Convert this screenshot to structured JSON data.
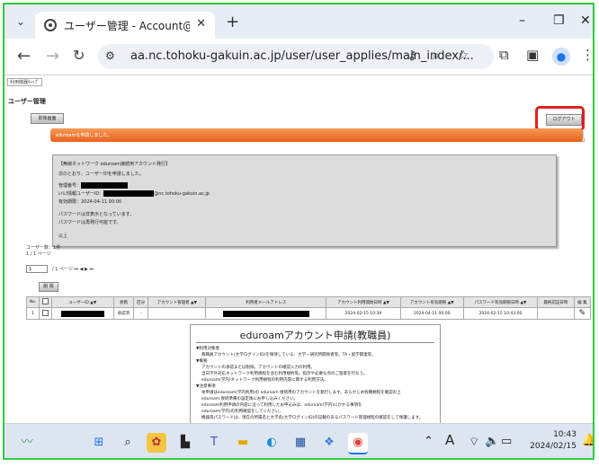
{
  "browser": {
    "tab_title": "ユーザー管理 - Account@Adapte",
    "url": "aa.nc.tohoku-gakuin.ac.jp/user/user_applies/main_index/..."
  },
  "page": {
    "breadcrumb": "利用機器ｷｬｯﾌﾟ",
    "title": "ユーザー管理",
    "menu_button": "前後画面",
    "logout_button": "ログアウト",
    "banner_text": "eduroamを申請しました。",
    "message_lines": [
      "【無線ネットワーク eduroam接続用アカウント発行】",
      "次のとおり、ユーザー印を申請しました。",
      "管理番号：",
      "ﾚｲﾑﾘ情報ユーザーID：",
      "@nc.tohoku-gakuin.ac.jp",
      "有効期限：2024-04-11 00:00",
      "パスワードは非表示となっています。",
      "パスワードは再発行可能です。",
      "以上"
    ],
    "count_line1": "ユーザー数：1件",
    "count_line2": "1 / 1 ページ",
    "pager_select": "1",
    "pager_text": "/ 1 ページ ⏮ ◀ ▶ ⏭",
    "delete_button": "削 除",
    "table": {
      "headers": [
        "No.",
        "",
        "ユーザーID ▲▼",
        "状態",
        "区分",
        "アカウント管理者 ▲▼",
        "利用者メールアドレス",
        "アカウント利用開始日時 ▲▼",
        "アカウント有効期限 ▲▼",
        "パスワード有効期限日時 ▲▼",
        "最終認証日時",
        "編 集"
      ],
      "row": {
        "no": "1",
        "status": "承認済",
        "kubun": "-",
        "start": "2024-02-15 10:39",
        "expire": "2024-04-11 00:00",
        "pw_expire": "2024-02-15 10:43:00"
      }
    },
    "overlay": {
      "title": "eduroamアカウント申請(教職員)",
      "lines": [
        "▼利用対象者",
        "教職員アカウント(大学ログインID)を保持している、大学・研究所関係者等。TA・留学関連等。",
        "▼概要",
        "アカウントの承認または削除。アカウントの確認入力の利用。",
        "当日学外対応ネットワーク利用規程を含む利用規約等。指示や必要な点のご留意を行なう。",
        "eduroam(学内)ネットワーク利用規程の利用内容に関する利用方法。",
        "▼注意事項",
        "本申請はeduroam(学内利用)の eduroam 接続用のアカウントを発行します。あらかじめ各種規程を確認の上",
        "eduroam 接続準備の設定後にお申し込みください。",
        "eduroam利用申請の内容に沿って利用したお申込みは、eduroam(学内)にかかる事項を",
        "eduroam(学内)の利用確認をしてください。",
        "機器等パスワードは、現在の所属名と大学名(大学ログインID)の記載のあるパスワード管理規程の確認をして保護します。"
      ]
    }
  },
  "taskbar": {
    "time": "10:43",
    "date": "2024/02/15"
  }
}
